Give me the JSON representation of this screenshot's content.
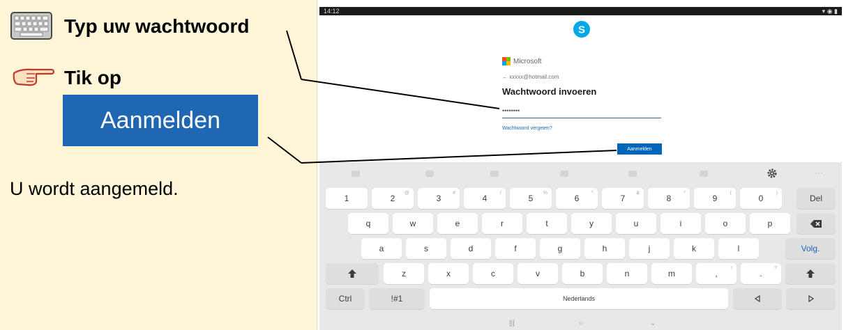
{
  "instructions": {
    "step1": "Typ uw wachtwoord",
    "step2": "Tik op",
    "sample_button": "Aanmelden",
    "result": "U wordt aangemeld."
  },
  "tablet": {
    "status_time": "14:12",
    "brand": "Microsoft",
    "email": "xxxxx@hotmail.com",
    "page_title": "Wachtwoord invoeren",
    "password_value": "••••••••",
    "forgot_link": "Wachtwoord vergeten?",
    "signin_button": "Aanmelden"
  },
  "keyboard": {
    "row1": [
      {
        "label": "1",
        "sub": ""
      },
      {
        "label": "2",
        "sub": "@"
      },
      {
        "label": "3",
        "sub": "#"
      },
      {
        "label": "4",
        "sub": "/"
      },
      {
        "label": "5",
        "sub": "%"
      },
      {
        "label": "6",
        "sub": "^"
      },
      {
        "label": "7",
        "sub": "&"
      },
      {
        "label": "8",
        "sub": "*"
      },
      {
        "label": "9",
        "sub": "("
      },
      {
        "label": "0",
        "sub": ")"
      }
    ],
    "del": "Del",
    "row2": [
      "q",
      "w",
      "e",
      "r",
      "t",
      "y",
      "u",
      "i",
      "o",
      "p"
    ],
    "row3": [
      "a",
      "s",
      "d",
      "f",
      "g",
      "h",
      "j",
      "k",
      "l"
    ],
    "next": "Volg.",
    "row4": [
      "z",
      "x",
      "c",
      "v",
      "b",
      "n",
      "m",
      ",",
      "."
    ],
    "row4_subs": [
      "",
      "",
      "",
      "",
      "",
      "",
      "",
      "!",
      "?"
    ],
    "ctrl": "Ctrl",
    "sym": "!#1",
    "space": "Nederlands",
    "icons": {
      "shift": "shift-icon",
      "backspace": "backspace-icon",
      "left": "arrow-left-icon",
      "right": "arrow-right-icon",
      "settings": "gear-icon"
    }
  },
  "colors": {
    "panel": "#fff6d9",
    "accent_blue": "#1f67b3",
    "ms_button": "#0067b8",
    "keyboard_bg": "#e8e8e8"
  }
}
